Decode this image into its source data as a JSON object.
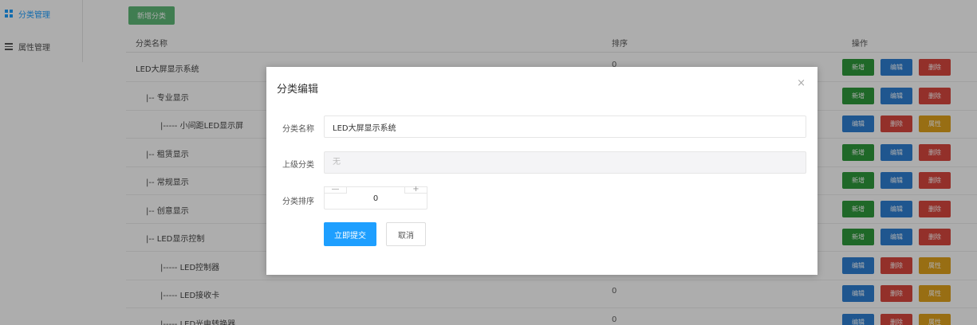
{
  "sidebar": {
    "items": [
      {
        "label": "分类管理",
        "icon": "grid-icon"
      },
      {
        "label": "属性管理",
        "icon": "list-icon"
      }
    ]
  },
  "toolbar": {
    "add_label": "新增分类"
  },
  "table": {
    "headers": [
      "分类名称",
      "排序",
      "操作"
    ],
    "rows": [
      {
        "name": "LED大屏显示系统",
        "sort": "0",
        "ops": [
          "新增",
          "编辑",
          "删除"
        ]
      },
      {
        "name": "|-- 专业显示",
        "sort": "",
        "ops": [
          "新增",
          "编辑",
          "删除"
        ]
      },
      {
        "name": "|----- 小间距LED显示屏",
        "sort": "",
        "ops": [
          "编辑",
          "删除",
          "属性"
        ]
      },
      {
        "name": "|-- 租赁显示",
        "sort": "",
        "ops": [
          "新增",
          "编辑",
          "删除"
        ]
      },
      {
        "name": "|-- 常规显示",
        "sort": "",
        "ops": [
          "新增",
          "编辑",
          "删除"
        ]
      },
      {
        "name": "|-- 创意显示",
        "sort": "",
        "ops": [
          "新增",
          "编辑",
          "删除"
        ]
      },
      {
        "name": "|-- LED显示控制",
        "sort": "",
        "ops": [
          "新增",
          "编辑",
          "删除"
        ]
      },
      {
        "name": "|----- LED控制器",
        "sort": "",
        "ops": [
          "编辑",
          "删除",
          "属性"
        ]
      },
      {
        "name": "|----- LED接收卡",
        "sort": "0",
        "ops": [
          "编辑",
          "删除",
          "属性"
        ]
      },
      {
        "name": "|----- LED光电转换器",
        "sort": "0",
        "ops": [
          "编辑",
          "删除",
          "属性"
        ]
      }
    ]
  },
  "dialog": {
    "title": "分类编辑",
    "close": "×",
    "name_label": "分类名称",
    "name_value": "LED大屏显示系统",
    "parent_label": "上级分类",
    "parent_value": "无",
    "sort_label": "分类排序",
    "sort_value": "0",
    "minus": "—",
    "plus": "+",
    "submit_label": "立即提交",
    "cancel_label": "取消"
  },
  "colors": {
    "accent": "#1e9fff",
    "green": "#2f9a3c",
    "blue": "#2e7fd3",
    "red": "#d9473e",
    "orange": "#e0a21c"
  }
}
